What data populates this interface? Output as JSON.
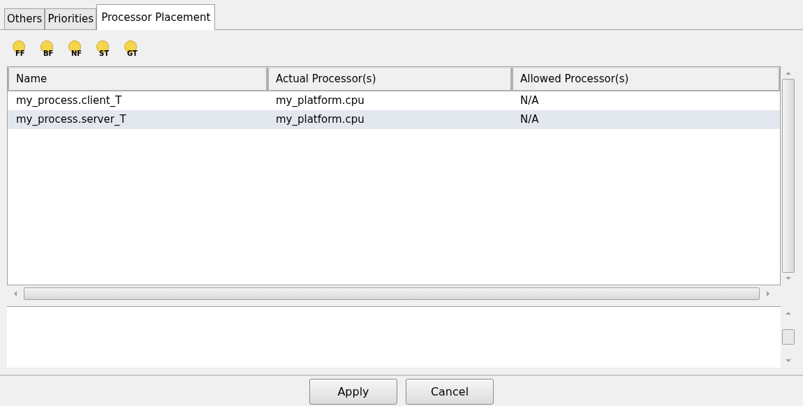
{
  "tabs": [
    {
      "label": "Others",
      "selected": false
    },
    {
      "label": "Priorities",
      "selected": false
    },
    {
      "label": "Processor Placement",
      "selected": true
    }
  ],
  "toolbar": [
    "FF",
    "BF",
    "NF",
    "ST",
    "GT"
  ],
  "table": {
    "columns": [
      "Name",
      "Actual Processor(s)",
      "Allowed Processor(s)"
    ],
    "rows": [
      {
        "cells": [
          "my_process.client_T",
          "my_platform.cpu",
          "N/A"
        ],
        "selected": false
      },
      {
        "cells": [
          "my_process.server_T",
          "my_platform.cpu",
          "N/A"
        ],
        "selected": true
      }
    ]
  },
  "buttons": [
    "Apply",
    "Cancel"
  ]
}
